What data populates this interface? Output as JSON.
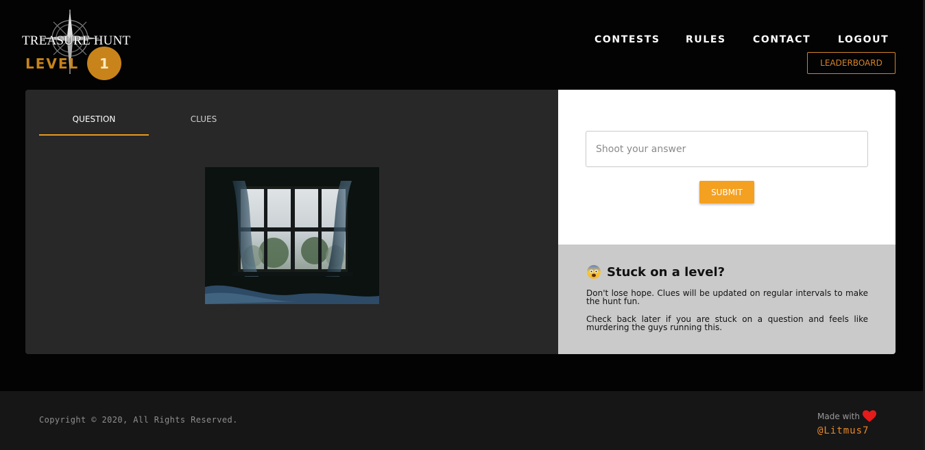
{
  "header": {
    "logo_text": "Treasure Hunt",
    "level_label": "LEVEL",
    "level_number": "1",
    "nav": [
      {
        "label": "CONTESTS"
      },
      {
        "label": "RULES"
      },
      {
        "label": "CONTACT"
      },
      {
        "label": "LOGOUT"
      }
    ],
    "leaderboard_label": "LEADERBOARD"
  },
  "tabs": [
    {
      "label": "QUESTION",
      "active": true
    },
    {
      "label": "CLUES",
      "active": false
    }
  ],
  "answer": {
    "placeholder": "Shoot your answer",
    "value": "",
    "submit_label": "SUBMIT"
  },
  "help": {
    "emoji": "fearful-face-icon",
    "title": "Stuck on a level?",
    "paragraph1": "Don't lose hope. Clues will be updated on regular intervals to make the hunt fun.",
    "paragraph2": "Check back later if you are stuck on a question and feels like murdering the guys running this."
  },
  "footer": {
    "copyright": "Copyright © 2020, All Rights Reserved.",
    "made_with": "Made with",
    "heart_icon": "heart-icon",
    "author": "@Litmus7"
  },
  "colors": {
    "accent": "#f4a020",
    "level": "#c8841a",
    "background": "#030303",
    "panel_dark": "#282828",
    "panel_grey": "#cacaca",
    "heart": "#e31b1b"
  }
}
